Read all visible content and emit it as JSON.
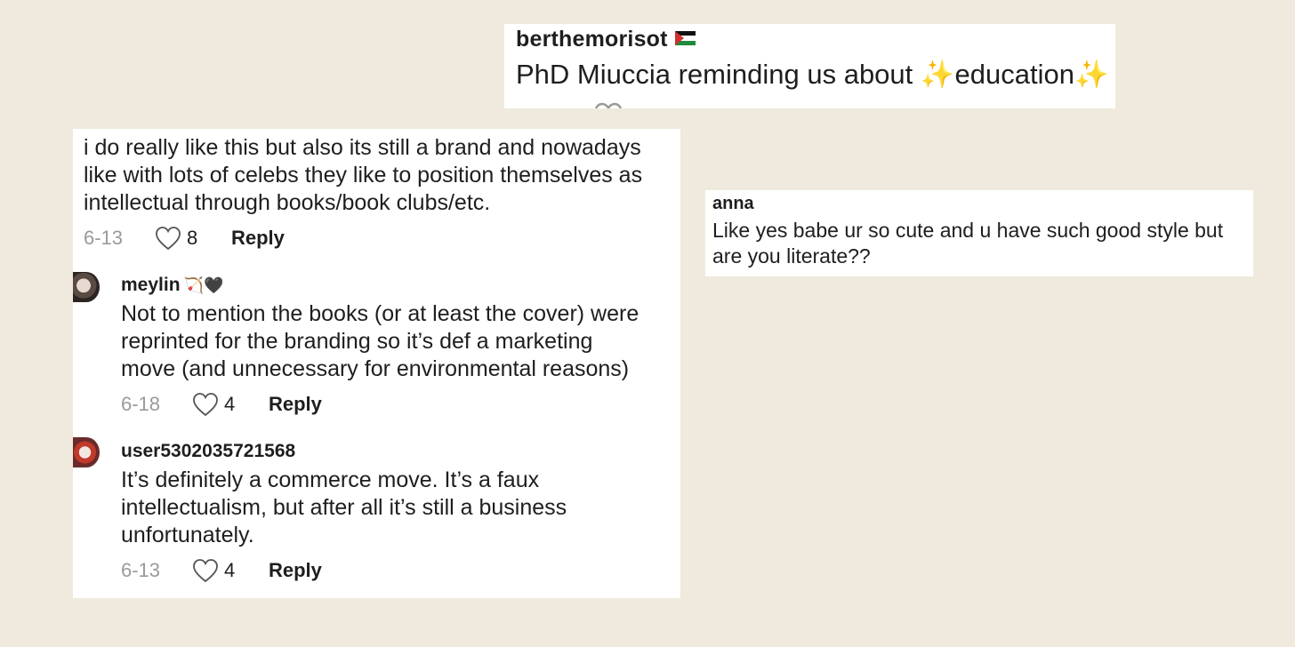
{
  "top_comment": {
    "username": "berthemorisot",
    "text_before": "PhD Miuccia reminding us about ",
    "sparkle": "✨",
    "text_word": "education"
  },
  "left_thread": {
    "parent": {
      "lines": [
        "i do really like this but also its still a brand and nowadays",
        "like with lots of celebs they like to position themselves as",
        "intellectual through books/book clubs/etc."
      ],
      "date": "6-13",
      "likes": "8",
      "reply_label": "Reply"
    },
    "replies": [
      {
        "username": "meylin",
        "emoji": "🏹🖤",
        "lines": [
          "Not to mention the books (or at least the cover) were",
          "reprinted for the branding so it’s def a marketing",
          "move (and unnecessary for environmental reasons)"
        ],
        "date": "6-18",
        "likes": "4",
        "reply_label": "Reply"
      },
      {
        "username": "user5302035721568",
        "lines": [
          "It’s definitely a commerce move. It’s a faux",
          "intellectualism, but after all it’s still a business",
          "unfortunately."
        ],
        "date": "6-13",
        "likes": "4",
        "reply_label": "Reply"
      }
    ]
  },
  "right_comment": {
    "username": "anna",
    "lines": [
      "Like yes babe ur so cute and u have such good style but",
      "are you literate??"
    ]
  },
  "colors": {
    "background": "#efeadd",
    "card": "#ffffff",
    "date_gray": "#9a9a9a",
    "text": "#1e1e1e"
  },
  "icons": [
    "heart-outline-icon",
    "palestine-flag-icon",
    "sparkle-icon",
    "avatar"
  ]
}
